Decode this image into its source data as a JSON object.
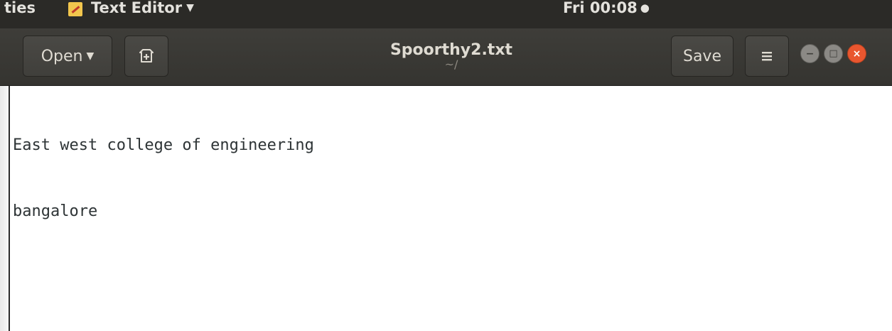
{
  "topbar": {
    "activities_label": "ties",
    "app_name": "Text Editor",
    "clock": "Fri 00:08"
  },
  "toolbar": {
    "open_label": "Open",
    "save_label": "Save"
  },
  "document": {
    "title": "Spoorthy2.txt",
    "path": "~/",
    "lines": [
      "East west college of engineering",
      "bangalore"
    ]
  },
  "icons": {
    "new_document": "new-document-icon",
    "hamburger": "hamburger-menu-icon",
    "minimize": "minimize-icon",
    "maximize": "maximize-icon",
    "close": "close-icon"
  },
  "colors": {
    "headerbar": "#3c3b37",
    "close_button": "#e9562f",
    "text": "#2e3436"
  }
}
